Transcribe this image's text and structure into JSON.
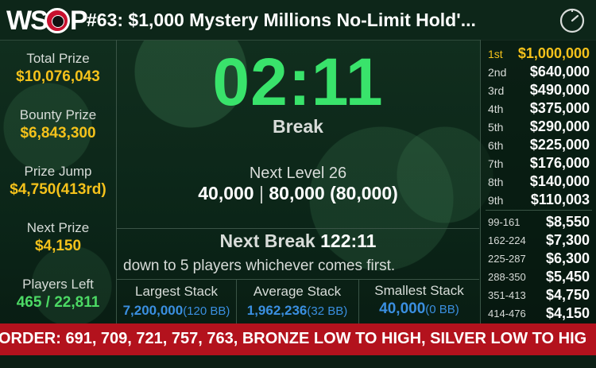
{
  "header": {
    "logo_text": "WSOP",
    "title": "#63: $1,000 Mystery Millions No-Limit Hold'..."
  },
  "left": {
    "total_prize_label": "Total Prize",
    "total_prize": "$10,076,043",
    "bounty_prize_label": "Bounty Prize",
    "bounty_prize": "$6,843,300",
    "prize_jump_label": "Prize Jump",
    "prize_jump": "$4,750(413rd)",
    "next_prize_label": "Next Prize",
    "next_prize": "$4,150",
    "players_left_label": "Players Left",
    "players_left": "465 / 22,811"
  },
  "center": {
    "timer": "02:11",
    "status": "Break",
    "next_level": "Next Level 26",
    "blind_small": "40,000",
    "blind_sep": "|",
    "blind_big": "80,000 (80,000)",
    "next_break_label": "Next Break",
    "next_break_time": "122:11",
    "scroll_message": "down to 5 players whichever comes first."
  },
  "stacks": {
    "largest_label": "Largest Stack",
    "largest_value": "7,200,000",
    "largest_bb": "(120 BB)",
    "average_label": "Average Stack",
    "average_value": "1,962,236",
    "average_bb": "(32 BB)",
    "smallest_label": "Smallest Stack",
    "smallest_value": "40,000",
    "smallest_bb": "(0 BB)"
  },
  "payouts": [
    {
      "place": "1st",
      "amount": "$1,000,000"
    },
    {
      "place": "2nd",
      "amount": "$640,000"
    },
    {
      "place": "3rd",
      "amount": "$490,000"
    },
    {
      "place": "4th",
      "amount": "$375,000"
    },
    {
      "place": "5th",
      "amount": "$290,000"
    },
    {
      "place": "6th",
      "amount": "$225,000"
    },
    {
      "place": "7th",
      "amount": "$176,000"
    },
    {
      "place": "8th",
      "amount": "$140,000"
    },
    {
      "place": "9th",
      "amount": "$110,003"
    },
    {
      "place": "99-161",
      "amount": "$8,550"
    },
    {
      "place": "162-224",
      "amount": "$7,300"
    },
    {
      "place": "225-287",
      "amount": "$6,300"
    },
    {
      "place": "288-350",
      "amount": "$5,450"
    },
    {
      "place": "351-413",
      "amount": "$4,750"
    },
    {
      "place": "414-476",
      "amount": "$4,150"
    }
  ],
  "ticker": "ORDER: 691, 709, 721, 757, 763, BRONZE LOW TO HIGH, SILVER LOW TO HIG",
  "colors": {
    "accent_gold": "#f5c21b",
    "timer_green": "#39e36b",
    "stack_blue": "#3a8fe0",
    "ticker_red": "#b3121d"
  }
}
